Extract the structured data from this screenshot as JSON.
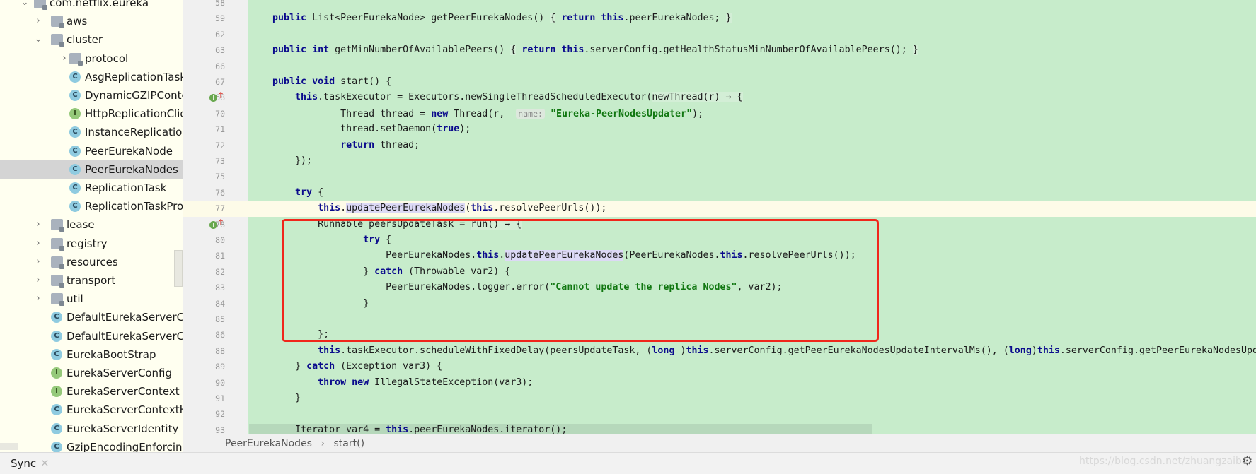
{
  "project_tree": {
    "items": [
      {
        "label": "com.netflix.eureka",
        "type": "package",
        "depth": 0,
        "expanded": true
      },
      {
        "label": "aws",
        "type": "package",
        "depth": 1,
        "expanded": false
      },
      {
        "label": "cluster",
        "type": "package",
        "depth": 1,
        "expanded": true
      },
      {
        "label": "protocol",
        "type": "package",
        "depth": 2,
        "expanded": false
      },
      {
        "label": "AsgReplicationTask",
        "type": "class",
        "depth": 2
      },
      {
        "label": "DynamicGZIPConte",
        "type": "class",
        "depth": 2
      },
      {
        "label": "HttpReplicationClie",
        "type": "interface",
        "depth": 2
      },
      {
        "label": "InstanceReplication",
        "type": "class",
        "depth": 2
      },
      {
        "label": "PeerEurekaNode",
        "type": "class",
        "depth": 2
      },
      {
        "label": "PeerEurekaNodes",
        "type": "class",
        "depth": 2,
        "selected": true
      },
      {
        "label": "ReplicationTask",
        "type": "class",
        "depth": 2
      },
      {
        "label": "ReplicationTaskPro",
        "type": "class",
        "depth": 2
      },
      {
        "label": "lease",
        "type": "package",
        "depth": 1,
        "expanded": false
      },
      {
        "label": "registry",
        "type": "package",
        "depth": 1,
        "expanded": false
      },
      {
        "label": "resources",
        "type": "package",
        "depth": 1,
        "expanded": false
      },
      {
        "label": "transport",
        "type": "package",
        "depth": 1,
        "expanded": false
      },
      {
        "label": "util",
        "type": "package",
        "depth": 1,
        "expanded": false
      },
      {
        "label": "DefaultEurekaServerCo",
        "type": "class",
        "depth": 1
      },
      {
        "label": "DefaultEurekaServerCo",
        "type": "class",
        "depth": 1
      },
      {
        "label": "EurekaBootStrap",
        "type": "class",
        "depth": 1
      },
      {
        "label": "EurekaServerConfig",
        "type": "interface",
        "depth": 1
      },
      {
        "label": "EurekaServerContext",
        "type": "interface",
        "depth": 1
      },
      {
        "label": "EurekaServerContextH",
        "type": "class",
        "depth": 1
      },
      {
        "label": "EurekaServerIdentity",
        "type": "class",
        "depth": 1
      },
      {
        "label": "GzipEncodingEnforcinc",
        "type": "class",
        "depth": 1
      }
    ]
  },
  "editor": {
    "current_line": "77",
    "lines": [
      {
        "n": "58",
        "segs": []
      },
      {
        "n": "59",
        "segs": [
          [
            "",
            "    "
          ],
          [
            "kw",
            "public"
          ],
          [
            "",
            " List<PeerEurekaNode> getPeerEurekaNodes() "
          ],
          [
            "fold",
            "{"
          ],
          [
            "",
            " "
          ],
          [
            "kw",
            "return"
          ],
          [
            "",
            " "
          ],
          [
            "kw",
            "this"
          ],
          [
            "",
            ".peerEurekaNodes; "
          ],
          [
            "fold",
            "}"
          ]
        ]
      },
      {
        "n": "62",
        "segs": []
      },
      {
        "n": "63",
        "segs": [
          [
            "",
            "    "
          ],
          [
            "kw",
            "public int"
          ],
          [
            "",
            " getMinNumberOfAvailablePeers() "
          ],
          [
            "fold",
            "{"
          ],
          [
            "",
            " "
          ],
          [
            "kw",
            "return"
          ],
          [
            "",
            " "
          ],
          [
            "kw",
            "this"
          ],
          [
            "",
            ".serverConfig.getHealthStatusMinNumberOfAvailablePeers(); "
          ],
          [
            "fold",
            "}"
          ]
        ]
      },
      {
        "n": "66",
        "segs": []
      },
      {
        "n": "67",
        "segs": [
          [
            "",
            "    "
          ],
          [
            "kw",
            "public void"
          ],
          [
            "",
            " start() {"
          ]
        ]
      },
      {
        "n": "68",
        "mark": true,
        "segs": [
          [
            "",
            "        "
          ],
          [
            "kw",
            "this"
          ],
          [
            "",
            ".taskExecutor = Executors.newSingleThreadScheduledExecutor("
          ],
          [
            "fold",
            "newThread(r) → {"
          ]
        ]
      },
      {
        "n": "70",
        "segs": [
          [
            "",
            "                Thread thread = "
          ],
          [
            "kw",
            "new"
          ],
          [
            "",
            " Thread(r,  "
          ],
          [
            "hint",
            "name:"
          ],
          [
            "",
            " "
          ],
          [
            "str",
            "\"Eureka-PeerNodesUpdater\""
          ],
          [
            "",
            ");"
          ]
        ]
      },
      {
        "n": "71",
        "segs": [
          [
            "",
            "                thread.setDaemon("
          ],
          [
            "kw",
            "true"
          ],
          [
            "",
            ");"
          ]
        ]
      },
      {
        "n": "72",
        "segs": [
          [
            "",
            "                "
          ],
          [
            "kw",
            "return"
          ],
          [
            "",
            " thread;"
          ]
        ]
      },
      {
        "n": "73",
        "segs": [
          [
            "",
            "        });"
          ]
        ]
      },
      {
        "n": "75",
        "segs": []
      },
      {
        "n": "76",
        "segs": [
          [
            "",
            "        "
          ],
          [
            "kw",
            "try"
          ],
          [
            "",
            " {"
          ]
        ]
      },
      {
        "n": "77",
        "segs": [
          [
            "",
            "            "
          ],
          [
            "kw",
            "this"
          ],
          [
            "",
            "."
          ],
          [
            "hl",
            "updatePeerEurekaNodes"
          ],
          [
            "",
            "("
          ],
          [
            "kw",
            "this"
          ],
          [
            "",
            ".resolvePeerUrls());"
          ]
        ]
      },
      {
        "n": "78",
        "mark": true,
        "segs": [
          [
            "",
            "            Runnable peersUpdateTask = "
          ],
          [
            "fold",
            "run() → {"
          ]
        ]
      },
      {
        "n": "80",
        "segs": [
          [
            "",
            "                    "
          ],
          [
            "kw",
            "try"
          ],
          [
            "",
            " {"
          ]
        ]
      },
      {
        "n": "81",
        "segs": [
          [
            "",
            "                        PeerEurekaNodes."
          ],
          [
            "kw",
            "this"
          ],
          [
            "",
            "."
          ],
          [
            "hl",
            "updatePeerEurekaNodes"
          ],
          [
            "",
            "(PeerEurekaNodes."
          ],
          [
            "kw",
            "this"
          ],
          [
            "",
            ".resolvePeerUrls());"
          ]
        ]
      },
      {
        "n": "82",
        "segs": [
          [
            "",
            "                    } "
          ],
          [
            "kw",
            "catch"
          ],
          [
            "",
            " (Throwable var2) {"
          ]
        ]
      },
      {
        "n": "83",
        "segs": [
          [
            "",
            "                        PeerEurekaNodes.logger.error("
          ],
          [
            "str",
            "\"Cannot update the replica Nodes\""
          ],
          [
            "",
            ", var2);"
          ]
        ]
      },
      {
        "n": "84",
        "segs": [
          [
            "",
            "                    }"
          ]
        ]
      },
      {
        "n": "85",
        "segs": []
      },
      {
        "n": "86",
        "segs": [
          [
            "",
            "            };"
          ]
        ]
      },
      {
        "n": "88",
        "segs": [
          [
            "",
            "            "
          ],
          [
            "kw",
            "this"
          ],
          [
            "",
            ".taskExecutor.scheduleWithFixedDelay(peersUpdateTask, ("
          ],
          [
            "kw",
            "long"
          ],
          [
            "",
            " )"
          ],
          [
            "kw",
            "this"
          ],
          [
            "",
            ".serverConfig.getPeerEurekaNodesUpdateIntervalMs(), ("
          ],
          [
            "kw",
            "long"
          ],
          [
            "",
            ")"
          ],
          [
            "kw",
            "this"
          ],
          [
            "",
            ".serverConfig.getPeerEurekaNodesUpda"
          ]
        ]
      },
      {
        "n": "89",
        "segs": [
          [
            "",
            "        } "
          ],
          [
            "kw",
            "catch"
          ],
          [
            "",
            " (Exception var3) {"
          ]
        ]
      },
      {
        "n": "90",
        "segs": [
          [
            "",
            "            "
          ],
          [
            "kw",
            "throw new"
          ],
          [
            "",
            " IllegalStateException(var3);"
          ]
        ]
      },
      {
        "n": "91",
        "segs": [
          [
            "",
            "        }"
          ]
        ]
      },
      {
        "n": "92",
        "segs": []
      },
      {
        "n": "93",
        "segs": [
          [
            "",
            "        Iterator var4 = "
          ],
          [
            "kw",
            "this"
          ],
          [
            "",
            ".peerEurekaNodes.iterator();"
          ]
        ]
      }
    ]
  },
  "breadcrumb": {
    "class_name": "PeerEurekaNodes",
    "separator": "›",
    "method": "start()"
  },
  "status_bar": {
    "tab_label": "Sync",
    "watermark": "https://blog.csdn.net/zhuangzaiba"
  },
  "colors": {
    "editor_bg": "#c7eccb",
    "keyword": "#0a0a8c",
    "string": "#117711",
    "highlight_box": "#f0261b"
  }
}
